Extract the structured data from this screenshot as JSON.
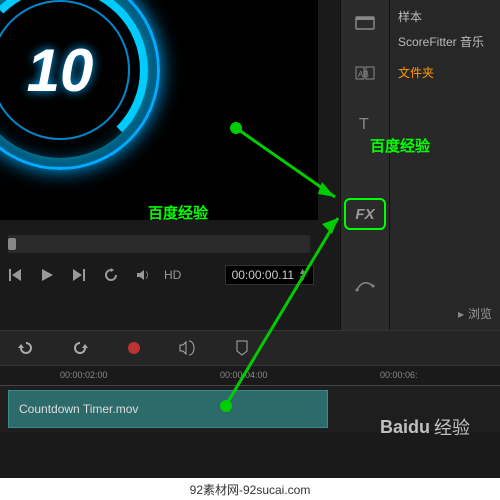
{
  "preview": {
    "countdown_number": "10"
  },
  "annotations": {
    "label1": "百度经验",
    "label2": "百度经验"
  },
  "transport": {
    "markout_chars": "[  ]",
    "hd_label": "HD",
    "timecode": "00:00:00.11"
  },
  "sidebar": {
    "fx_label": "FX"
  },
  "rpanel": {
    "sample": "样本",
    "scorefitter": "ScoreFitter 音乐",
    "folder": "文件夹",
    "browse": "浏览"
  },
  "timeline": {
    "ticks": [
      "00:00:02:00",
      "00:00:04:00",
      "00:00:06:"
    ],
    "clip_name": "Countdown Timer.mov"
  },
  "watermark": {
    "brand": "Baidu",
    "text": "经验"
  },
  "footer": "92素材网-92sucai.com"
}
